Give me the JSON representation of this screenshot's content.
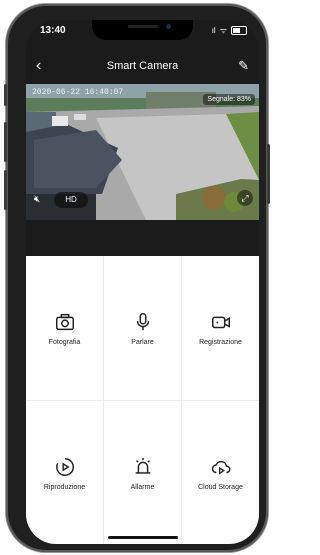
{
  "status_bar": {
    "time": "13:40",
    "signal": "ıl",
    "wifi": "ᯤ"
  },
  "nav": {
    "back_icon": "chevron-left",
    "title": "Smart Camera",
    "edit_icon": "pencil"
  },
  "video": {
    "timestamp": "2020-06-22 16:40:07",
    "signal_label": "Segnale: 83%",
    "hd_label": "HD",
    "mute_icon": "speaker-muted",
    "fullscreen_icon": "fullscreen"
  },
  "actions": [
    {
      "label": "Fotografia",
      "icon": "camera-icon"
    },
    {
      "label": "Parlare",
      "icon": "microphone-icon"
    },
    {
      "label": "Registrazione",
      "icon": "video-camera-icon"
    },
    {
      "label": "Riproduzione",
      "icon": "playback-icon"
    },
    {
      "label": "Allarme",
      "icon": "alarm-icon"
    },
    {
      "label": "Cloud Storage",
      "icon": "cloud-icon"
    }
  ]
}
